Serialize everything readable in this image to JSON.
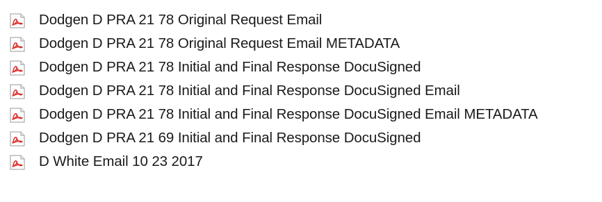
{
  "file_list": {
    "items": [
      {
        "name": "Dodgen D PRA 21 78 Original Request Email",
        "icon": "pdf-file-icon"
      },
      {
        "name": "Dodgen D PRA 21 78 Original Request Email METADATA",
        "icon": "pdf-file-icon"
      },
      {
        "name": "Dodgen D PRA 21 78 Initial and Final Response DocuSigned",
        "icon": "pdf-file-icon"
      },
      {
        "name": "Dodgen D PRA 21 78 Initial and Final Response DocuSigned Email",
        "icon": "pdf-file-icon"
      },
      {
        "name": "Dodgen D PRA 21 78 Initial and Final Response DocuSigned Email METADATA",
        "icon": "pdf-file-icon"
      },
      {
        "name": "Dodgen D PRA 21 69 Initial and Final Response DocuSigned",
        "icon": "pdf-file-icon"
      },
      {
        "name": "D White Email 10 23 2017",
        "icon": "pdf-file-icon"
      }
    ]
  },
  "colors": {
    "icon_red": "#d9302b",
    "icon_page": "#ffffff",
    "icon_border": "#9a9a9a",
    "text": "#1a1a1a"
  }
}
